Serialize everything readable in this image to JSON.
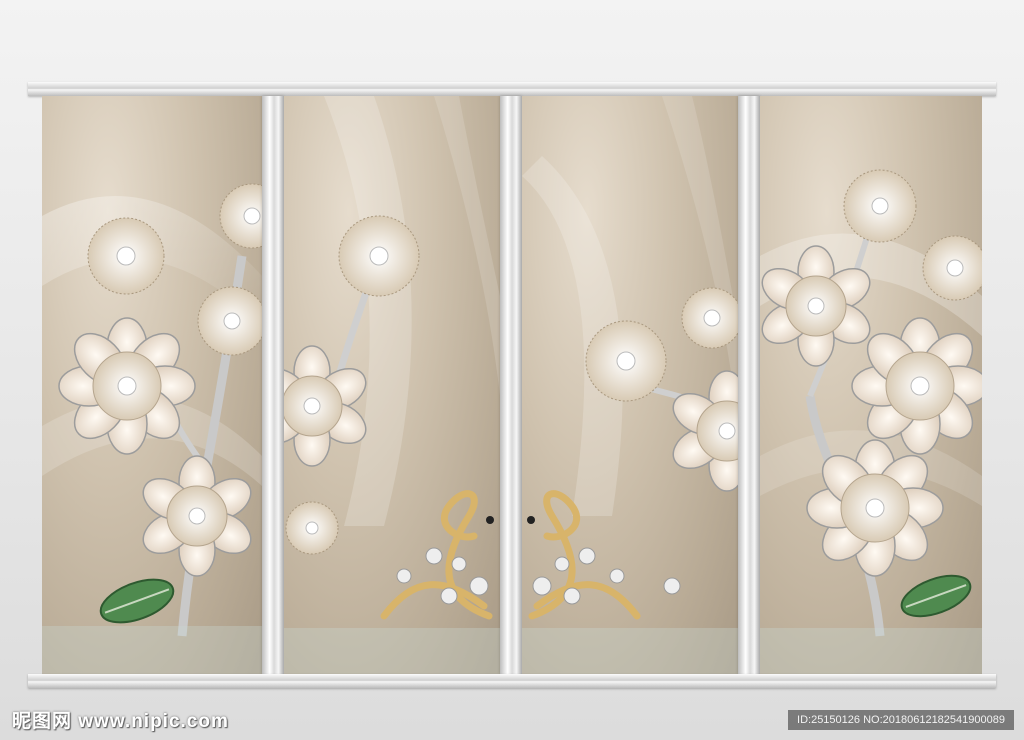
{
  "image": {
    "description_colors": {
      "satin": "#c9bba7",
      "frame": "#e9e9e9",
      "gold": "#d8b46a",
      "pearl": "#f4ede2",
      "leaf": "#4f8a4f"
    }
  },
  "watermark": {
    "site_text": "昵图网 www.nipic.com",
    "id_text": "ID:25150126 NO:20180612182541900089"
  }
}
